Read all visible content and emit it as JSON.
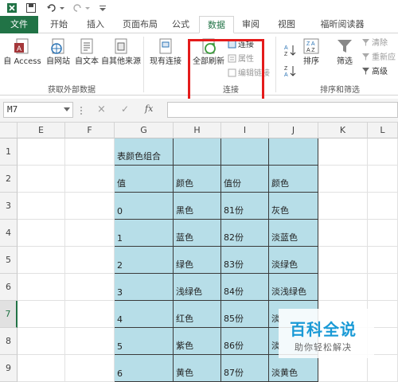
{
  "ribbon_tabs": [
    {
      "label": "文件"
    },
    {
      "label": "开始"
    },
    {
      "label": "插入"
    },
    {
      "label": "页面布局"
    },
    {
      "label": "公式"
    },
    {
      "label": "数据"
    },
    {
      "label": "审阅"
    },
    {
      "label": "视图"
    },
    {
      "label": "福昕阅读器"
    }
  ],
  "ribbon": {
    "external": {
      "access": "自 Access",
      "web": "自网站",
      "text": "自文本",
      "other": "自其他来源",
      "group_label": "获取外部数据"
    },
    "existing": "现有连接",
    "refresh_all": "全部刷新",
    "connections": {
      "conn": "连接",
      "props": "属性",
      "edit_links": "编辑链接",
      "group_label": "连接"
    },
    "sort_filter": {
      "sort": "排序",
      "filter": "筛选",
      "clear": "清除",
      "reapply": "重新应",
      "advanced": "高级",
      "group_label": "排序和筛选"
    }
  },
  "formula_bar": {
    "name_box": "M7",
    "cancel": "×",
    "enter": "✓",
    "fx": "fx"
  },
  "columns": [
    "E",
    "F",
    "G",
    "H",
    "I",
    "J",
    "K",
    "L"
  ],
  "rows": [
    "1",
    "2",
    "3",
    "4",
    "5",
    "6",
    "7",
    "8",
    "9"
  ],
  "table": [
    [
      "表颜色组合",
      "",
      "",
      ""
    ],
    [
      "值",
      "颜色",
      "值份",
      "颜色"
    ],
    [
      "0",
      "黑色",
      "81份",
      "灰色"
    ],
    [
      "1",
      "蓝色",
      "82份",
      "淡蓝色"
    ],
    [
      "2",
      "绿色",
      "83份",
      "淡绿色"
    ],
    [
      "3",
      "浅绿色",
      "84份",
      "淡浅绿色"
    ],
    [
      "4",
      "红色",
      "85份",
      "淡"
    ],
    [
      "5",
      "紫色",
      "86份",
      "淡"
    ],
    [
      "6",
      "黄色",
      "87份",
      "淡黄色"
    ]
  ],
  "watermark": {
    "title": "百科全说",
    "subtitle": "助你轻松解决"
  },
  "colors": {
    "accent": "#217346",
    "table_fill": "#b7dee8",
    "highlight": "#e41b1b"
  }
}
